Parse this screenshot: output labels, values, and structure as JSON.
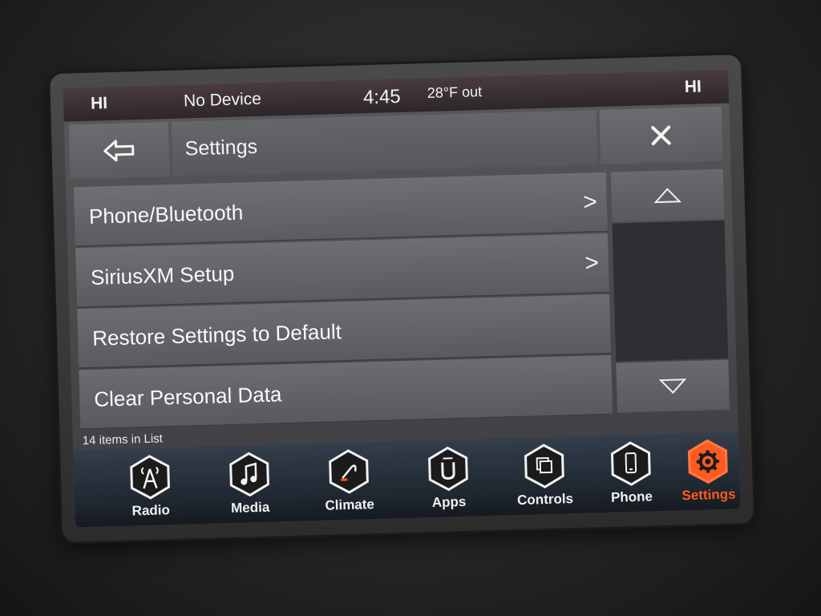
{
  "status_bar": {
    "left_temp": "HI",
    "device": "No Device",
    "time": "4:45",
    "outside_temp": "28°F out",
    "right_temp": "HI"
  },
  "header": {
    "back_icon": "back-arrow-icon",
    "title": "Settings",
    "close_icon": "close-icon"
  },
  "list": {
    "items": [
      {
        "label": "Phone/Bluetooth",
        "has_chevron": true
      },
      {
        "label": "SiriusXM Setup",
        "has_chevron": true
      },
      {
        "label": "Restore Settings to Default",
        "has_chevron": false
      },
      {
        "label": "Clear Personal Data",
        "has_chevron": false
      }
    ],
    "count_text": "14 items in List",
    "chevron": ">"
  },
  "nav": {
    "items": [
      {
        "label": "Radio",
        "icon": "radio-tower-icon"
      },
      {
        "label": "Media",
        "icon": "music-note-icon"
      },
      {
        "label": "Climate",
        "icon": "climate-icon"
      },
      {
        "label": "Apps",
        "icon": "apps-icon"
      },
      {
        "label": "Controls",
        "icon": "controls-icon"
      },
      {
        "label": "Phone",
        "icon": "phone-icon"
      },
      {
        "label": "Settings",
        "icon": "gear-icon",
        "active": true
      }
    ]
  },
  "colors": {
    "accent": "#ff5a1f",
    "text": "#f4f4f4"
  }
}
